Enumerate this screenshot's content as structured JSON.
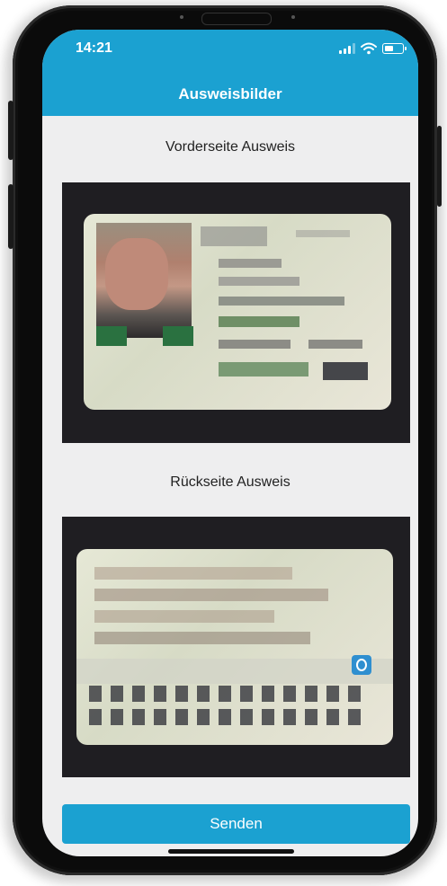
{
  "status_bar": {
    "time": "14:21"
  },
  "header": {
    "title": "Ausweisbilder"
  },
  "front": {
    "title": "Vorderseite Ausweis"
  },
  "back": {
    "title": "Rückseite Ausweis"
  },
  "actions": {
    "send_label": "Senden"
  },
  "colors": {
    "accent": "#1ba1d1",
    "background": "#eeeeef",
    "text": "#222222"
  },
  "icons": {
    "signal": "signal-icon",
    "wifi": "wifi-icon",
    "battery": "battery-icon"
  }
}
